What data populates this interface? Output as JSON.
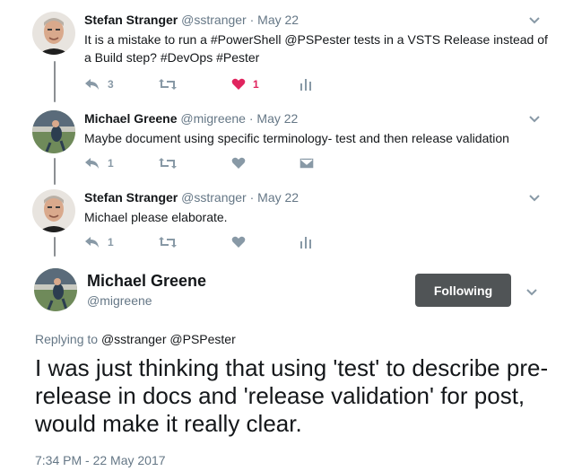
{
  "replies": [
    {
      "name": "Stefan Stranger",
      "handle": "@sstranger",
      "separator": "·",
      "time": "May 22",
      "text": "It is a mistake to run a #PowerShell @PSPester tests in a VSTS Release instead of a Build step? #DevOps #Pester",
      "reply_count": "3",
      "like_count": "1",
      "liked": true,
      "last_action_icon": "analytics-icon"
    },
    {
      "name": "Michael Greene",
      "handle": "@migreene",
      "separator": "·",
      "time": "May 22",
      "text": "Maybe document using specific terminology- test and then release validation",
      "reply_count": "1",
      "like_count": "",
      "liked": false,
      "last_action_icon": "direct-message-icon"
    },
    {
      "name": "Stefan Stranger",
      "handle": "@sstranger",
      "separator": "·",
      "time": "May 22",
      "text": "Michael please elaborate.",
      "reply_count": "1",
      "like_count": "",
      "liked": false,
      "last_action_icon": "analytics-icon"
    }
  ],
  "main_tweet": {
    "name": "Michael Greene",
    "handle": "@migreene",
    "follow_button": "Following",
    "replying_prefix": "Replying to",
    "replying_to": "@sstranger @PSPester",
    "text": "I was just thinking that using 'test' to describe pre-release in docs and 'release validation' for post, would make it really clear.",
    "timestamp": "7:34 PM - 22 May 2017"
  },
  "colors": {
    "name": "#14171a",
    "meta": "#657786",
    "action_icon": "#8899a6",
    "like_active": "#e0245e",
    "thread_line": "#8b8f93",
    "follow_button_bg": "#505456"
  }
}
